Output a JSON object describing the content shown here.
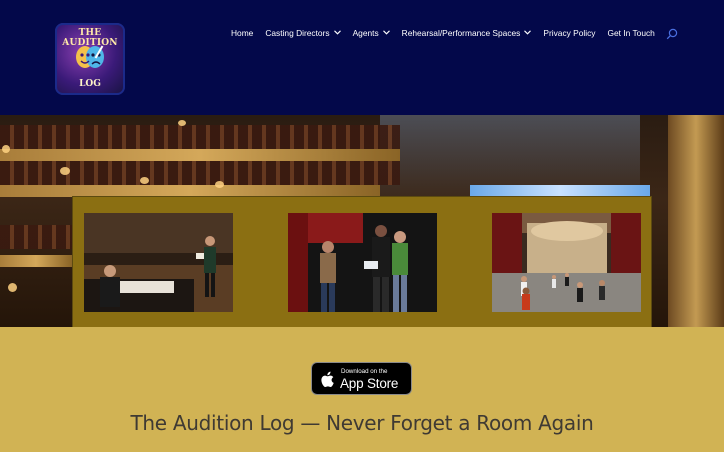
{
  "logo": {
    "line1": "THE AUDITION",
    "line2": "LOG"
  },
  "nav": {
    "items": [
      {
        "label": "Home",
        "dropdown": false
      },
      {
        "label": "Casting Directors",
        "dropdown": true
      },
      {
        "label": "Agents",
        "dropdown": true
      },
      {
        "label": "Rehearsal/Performance Spaces",
        "dropdown": true
      },
      {
        "label": "Privacy Policy",
        "dropdown": false
      },
      {
        "label": "Get In Touch",
        "dropdown": false
      }
    ],
    "chevron": "⌄",
    "search_icon": "search-icon"
  },
  "hero": {
    "photos": [
      {
        "name": "audition-panel-photo"
      },
      {
        "name": "scene-partners-photo"
      },
      {
        "name": "theatre-stage-rehearsal-photo"
      }
    ]
  },
  "app_store": {
    "small_text": "Download on the",
    "big_text": "App Store"
  },
  "headline": "The Audition Log — Never Forget a Room Again",
  "colors": {
    "header_bg": "#03084a",
    "panel_bg": "#8b6f12",
    "band_bg": "#d1b354",
    "headline": "#3f3a33"
  }
}
